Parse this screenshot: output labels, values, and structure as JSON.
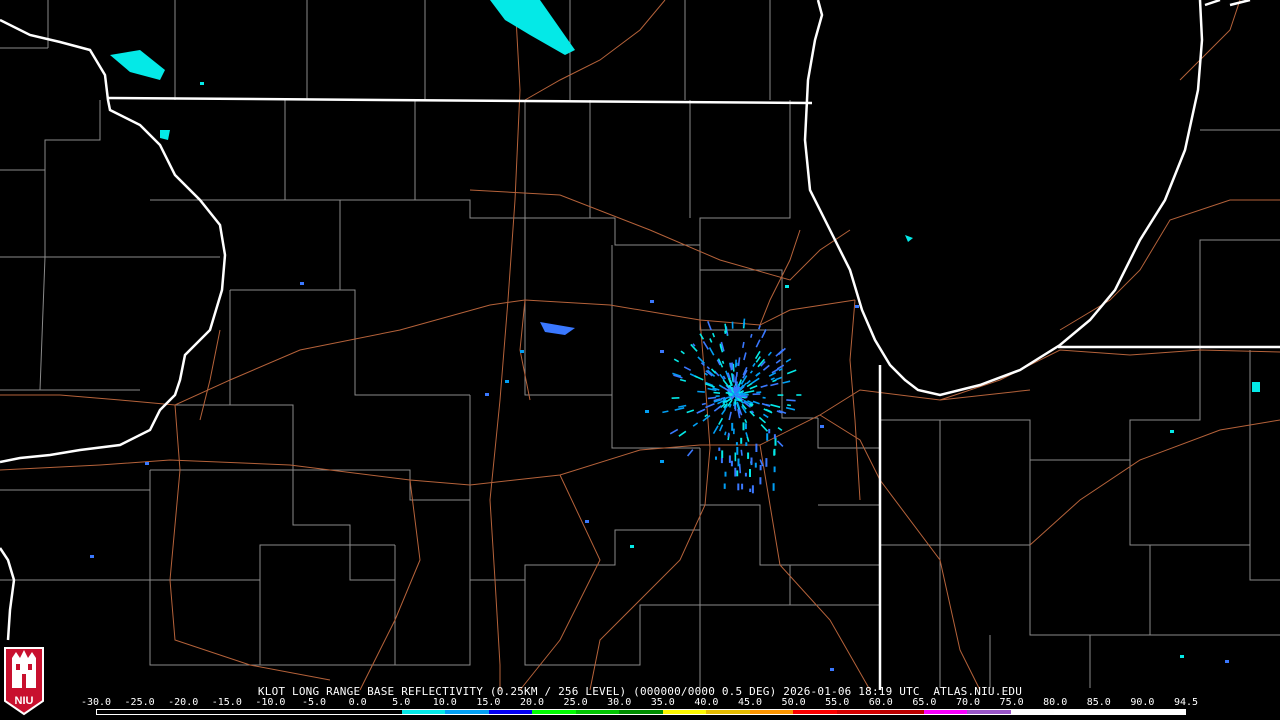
{
  "product": {
    "caption": "KLOT LONG RANGE BASE REFLECTIVITY (0.25KM / 256 LEVEL) (000000/0000 0.5 DEG) 2026-01-06 18:19 UTC  ATLAS.NIU.EDU"
  },
  "logo": {
    "text": "NIU",
    "color": "#c8102e"
  },
  "scale": {
    "labels": [
      "-30.0",
      "-25.0",
      "-20.0",
      "-15.0",
      "-10.0",
      "-5.0",
      "0.0",
      "5.0",
      "10.0",
      "15.0",
      "20.0",
      "25.0",
      "30.0",
      "35.0",
      "40.0",
      "45.0",
      "50.0",
      "55.0",
      "60.0",
      "65.0",
      "70.0",
      "75.0",
      "80.0",
      "85.0",
      "90.0",
      "94.5"
    ],
    "colors": [
      "#000000",
      "#000000",
      "#000000",
      "#000000",
      "#000000",
      "#000000",
      "#000000",
      "#04e9e7",
      "#019ff4",
      "#0300f4",
      "#02fd02",
      "#01c501",
      "#008e00",
      "#fdf802",
      "#e5bc00",
      "#fd9500",
      "#fd0000",
      "#d40000",
      "#bc0000",
      "#f800fd",
      "#9854c6",
      "#fdfdfd",
      "#ffffff",
      "#ffffff",
      "#ffffff"
    ]
  },
  "map": {
    "state_border_color": "#ffffff",
    "county_line_color": "#8a8a8a",
    "road_color": "#b5623a",
    "echo_colors": [
      "#04e9e7",
      "#019ff4",
      "#3a78ff"
    ]
  }
}
